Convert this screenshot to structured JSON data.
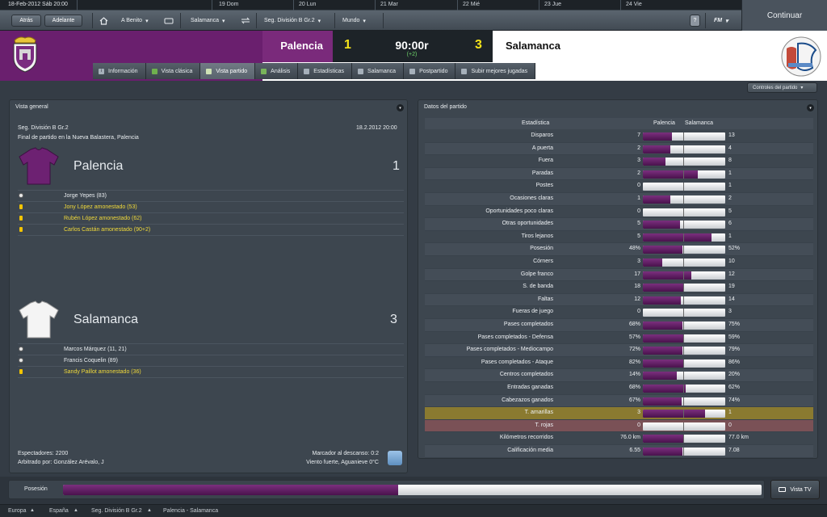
{
  "topbar": {
    "date": "18-Feb-2012  Sáb  20:00",
    "days": [
      "19  Dom",
      "20  Lun",
      "21  Mar",
      "22  Mié",
      "23  Jue",
      "24  Vie"
    ]
  },
  "continue_label": "Continuar",
  "toolbar": {
    "back": "Atrás",
    "forward": "Adelante",
    "manager": "A Benito",
    "club": "Salamanca",
    "competition": "Seg. División B Gr.2",
    "world": "Mundo",
    "help": "?",
    "fm": "FM"
  },
  "header": {
    "home_team": "Palencia",
    "home_score": "1",
    "clock": "90:00r",
    "added_time": "(+2)",
    "away_score": "3",
    "away_team": "Salamanca"
  },
  "tabs": [
    {
      "label": "Información",
      "icon": "info-icon"
    },
    {
      "label": "Vista clásica",
      "icon": "pitch-icon"
    },
    {
      "label": "Vista partido",
      "icon": "match-icon"
    },
    {
      "label": "Análisis",
      "icon": "chart-icon"
    },
    {
      "label": "Estadísticas",
      "icon": "stats-icon"
    },
    {
      "label": "Salamanca",
      "icon": "team-icon"
    },
    {
      "label": "Postpartido",
      "icon": "whistle-icon"
    },
    {
      "label": "Subir mejores jugadas",
      "icon": "upload-icon"
    }
  ],
  "controls_label": "Controles del partido",
  "overview": {
    "title": "Vista general",
    "competition": "Seg. División B Gr.2",
    "datetime": "18.2.2012 20:00",
    "venue": "Final de partido en la Nueva Balastera, Palencia",
    "home": {
      "name": "Palencia",
      "score": "1",
      "events": [
        {
          "text": "Jorge Yepes (83)",
          "type": "goal"
        },
        {
          "text": "Jony López amonestado (53)",
          "type": "yellow"
        },
        {
          "text": "Rubén López amonestado (62)",
          "type": "yellow"
        },
        {
          "text": "Carlos Castán amonestado (90+2)",
          "type": "yellow"
        }
      ]
    },
    "away": {
      "name": "Salamanca",
      "score": "3",
      "events": [
        {
          "text": "Marcos Márquez (11, 21)",
          "type": "goal"
        },
        {
          "text": "Francis Coquelin (89)",
          "type": "goal"
        },
        {
          "text": "Sandy Paillot amonestado (36)",
          "type": "yellow"
        }
      ]
    },
    "spectators": "Espectadores: 2200",
    "referee": "Arbitrado por: González Arévalo, J",
    "halftime": "Marcador al descanso: 0:2",
    "weather": "Viento fuerte, Aguanieve 0°C"
  },
  "stats": {
    "title": "Datos del partido",
    "col_stat": "Estadística",
    "col_home": "Palencia",
    "col_away": "Salamanca",
    "rows": [
      {
        "label": "Disparos",
        "home": "7",
        "away": "13",
        "share": 0.35
      },
      {
        "label": "A puerta",
        "home": "2",
        "away": "4",
        "share": 0.333
      },
      {
        "label": "Fuera",
        "home": "3",
        "away": "8",
        "share": 0.273
      },
      {
        "label": "Paradas",
        "home": "2",
        "away": "1",
        "share": 0.667
      },
      {
        "label": "Postes",
        "home": "0",
        "away": "1",
        "share": 0.0
      },
      {
        "label": "Ocasiones claras",
        "home": "1",
        "away": "2",
        "share": 0.333
      },
      {
        "label": "Oportunidades poco claras",
        "home": "0",
        "away": "5",
        "share": 0.0
      },
      {
        "label": "Otras oportunidades",
        "home": "5",
        "away": "6",
        "share": 0.455
      },
      {
        "label": "Tiros lejanos",
        "home": "5",
        "away": "1",
        "share": 0.833
      },
      {
        "label": "Posesión",
        "home": "48%",
        "away": "52%",
        "share": 0.48
      },
      {
        "label": "Córners",
        "home": "3",
        "away": "10",
        "share": 0.231
      },
      {
        "label": "Golpe franco",
        "home": "17",
        "away": "12",
        "share": 0.586
      },
      {
        "label": "S. de banda",
        "home": "18",
        "away": "19",
        "share": 0.486
      },
      {
        "label": "Faltas",
        "home": "12",
        "away": "14",
        "share": 0.462
      },
      {
        "label": "Fueras de juego",
        "home": "0",
        "away": "3",
        "share": 0.0
      },
      {
        "label": "Pases completados",
        "home": "68%",
        "away": "75%",
        "share": 0.476
      },
      {
        "label": "Pases completados - Defensa",
        "home": "57%",
        "away": "59%",
        "share": 0.491
      },
      {
        "label": "Pases completados - Mediocampo",
        "home": "72%",
        "away": "79%",
        "share": 0.477
      },
      {
        "label": "Pases completados - Ataque",
        "home": "82%",
        "away": "86%",
        "share": 0.488
      },
      {
        "label": "Centros completados",
        "home": "14%",
        "away": "20%",
        "share": 0.412
      },
      {
        "label": "Entradas ganadas",
        "home": "68%",
        "away": "62%",
        "share": 0.523
      },
      {
        "label": "Cabezazos ganados",
        "home": "67%",
        "away": "74%",
        "share": 0.475
      },
      {
        "label": "T. amarillas",
        "home": "3",
        "away": "1",
        "share": 0.75,
        "highlight": "yellow"
      },
      {
        "label": "T. rojas",
        "home": "0",
        "away": "0",
        "share": 0.0,
        "highlight": "red"
      },
      {
        "label": "Kilómetros recorridos",
        "home": "76.0 km",
        "away": "77.0 km",
        "share": 0.497
      },
      {
        "label": "Calificación media",
        "home": "6.55",
        "away": "7.08",
        "share": 0.481
      }
    ]
  },
  "possession": {
    "label": "Posesión",
    "home_share": 0.48
  },
  "tv_label": "Vista TV",
  "breadcrumb": [
    "Europa",
    "España",
    "Seg. División B Gr.2",
    "Palencia - Salamanca"
  ],
  "colors": {
    "home": "#6a1f6e",
    "accent": "#f5e31a",
    "added": "#6fd66a"
  }
}
